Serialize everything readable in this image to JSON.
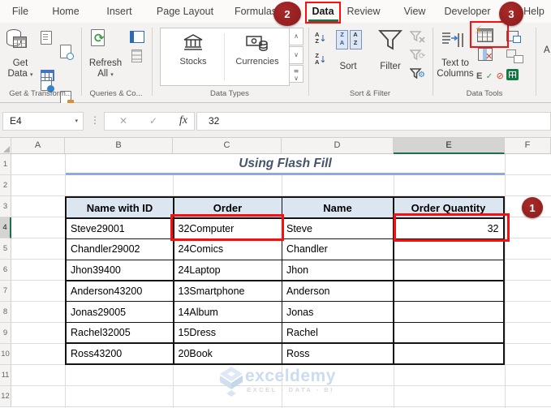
{
  "tabs": {
    "items": [
      "File",
      "Home",
      "Insert",
      "Page Layout",
      "Formulas",
      "Data",
      "Review",
      "View",
      "Developer",
      "Help"
    ],
    "active": "Data"
  },
  "badges": {
    "one": "1",
    "two": "2",
    "three": "3"
  },
  "ribbon": {
    "groups": [
      {
        "label": "Get & Transform..."
      },
      {
        "label": "Queries & Co..."
      },
      {
        "label": "Data Types"
      },
      {
        "label": "Sort & Filter"
      },
      {
        "label": "Data Tools"
      }
    ],
    "get_data": {
      "line1": "Get",
      "line2": "Data"
    },
    "refresh_all": {
      "line1": "Refresh",
      "line2": "All"
    },
    "stocks_label": "Stocks",
    "currencies_label": "Currencies",
    "sort_label": "Sort",
    "filter_label": "Filter",
    "text_to_columns": {
      "line1": "Text to",
      "line2": "Columns"
    },
    "next_group_partial": "A"
  },
  "formula_bar": {
    "name_box": "E4",
    "fx": "fx",
    "value": "32"
  },
  "sheet": {
    "column_headers": [
      "A",
      "B",
      "C",
      "D",
      "E",
      "F"
    ],
    "row_headers": [
      "1",
      "2",
      "3",
      "4",
      "5",
      "6",
      "7",
      "8",
      "9",
      "10",
      "11",
      "12"
    ],
    "selected_column": "E",
    "selected_row": "4",
    "title": "Using Flash Fill"
  },
  "table": {
    "headers": [
      "Name with ID",
      "Order",
      "Name",
      "Order Quantity"
    ],
    "rows": [
      [
        "Steve29001",
        "32Computer",
        "Steve",
        "32"
      ],
      [
        "Chandler29002",
        "24Comics",
        "Chandler",
        ""
      ],
      [
        "Jhon39400",
        "24Laptop",
        "Jhon",
        ""
      ],
      [
        "Anderson43200",
        "13Smartphone",
        "Anderson",
        ""
      ],
      [
        "Jonas29005",
        "14Album",
        "Jonas",
        ""
      ],
      [
        "Rachel32005",
        "15Dress",
        "Rachel",
        ""
      ],
      [
        "Ross43200",
        "20Book",
        "Ross",
        ""
      ]
    ]
  },
  "watermark": {
    "brand": "exceldemy",
    "tagline": "EXCEL - DATA - BI"
  },
  "colors": {
    "accent_green": "#1e7145",
    "annotation_red": "#fd0d0d",
    "badge_maroon": "#9b1c1c",
    "table_header_bg": "#dce6f1",
    "title_text": "#44546a",
    "title_underline": "#8ea9db"
  }
}
